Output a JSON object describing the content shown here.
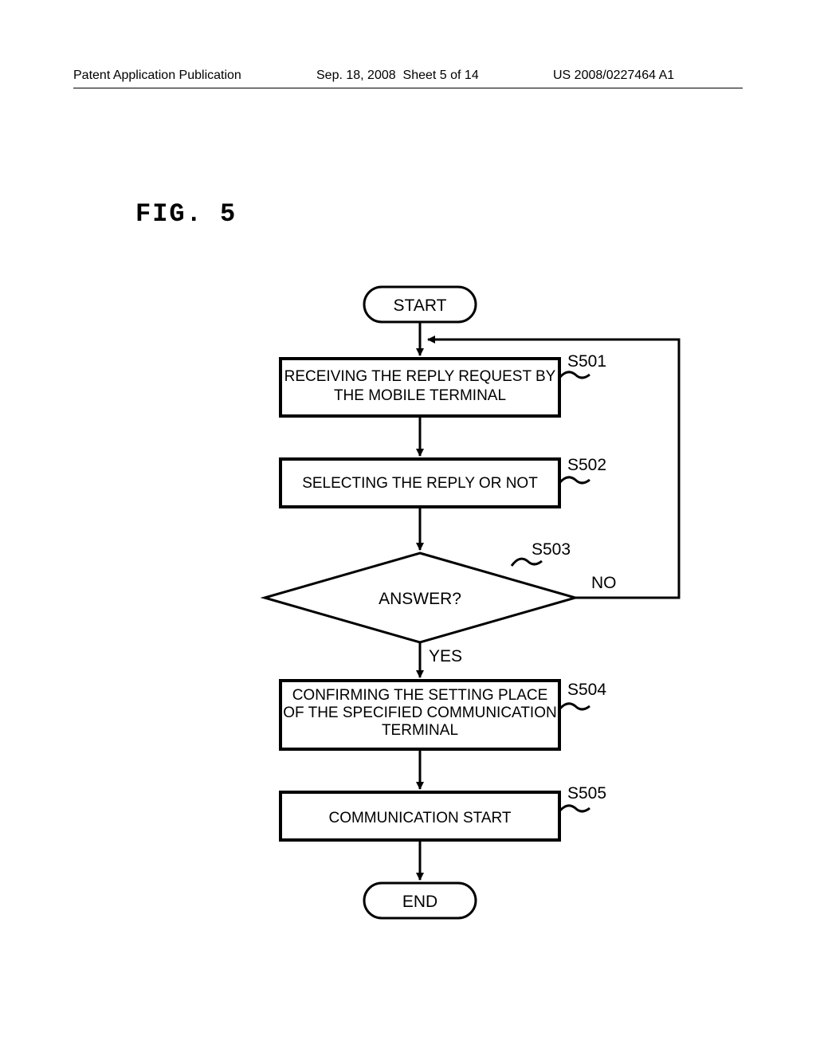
{
  "header": {
    "left": "Patent Application Publication",
    "mid_date": "Sep. 18, 2008",
    "mid_sheet": "Sheet 5 of 14",
    "right": "US 2008/0227464 A1"
  },
  "figure_label": "FIG. 5",
  "flow": {
    "start": "START",
    "end": "END",
    "steps": {
      "s501": {
        "label": "S501",
        "text_line1": "RECEIVING THE REPLY REQUEST BY",
        "text_line2": "THE MOBILE TERMINAL"
      },
      "s502": {
        "label": "S502",
        "text_line1": "SELECTING THE REPLY OR NOT"
      },
      "s503": {
        "label": "S503",
        "text_line1": "ANSWER?",
        "yes": "YES",
        "no": "NO"
      },
      "s504": {
        "label": "S504",
        "text_line1": "CONFIRMING THE SETTING PLACE",
        "text_line2": "OF THE SPECIFIED COMMUNICATION",
        "text_line3": "TERMINAL"
      },
      "s505": {
        "label": "S505",
        "text_line1": "COMMUNICATION START"
      }
    }
  }
}
